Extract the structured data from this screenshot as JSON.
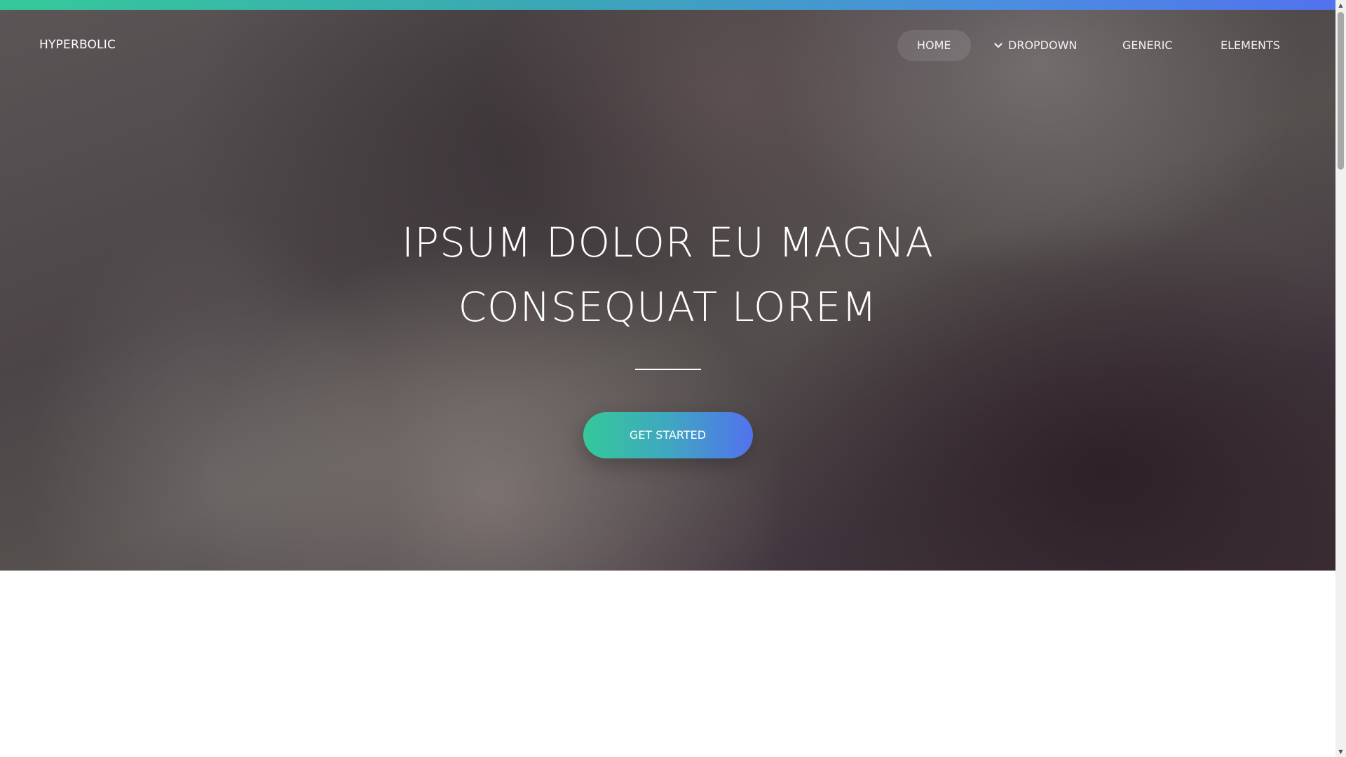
{
  "brand": {
    "name": "HYPERBOLIC"
  },
  "nav": {
    "items": [
      {
        "label": "HOME",
        "active": true
      },
      {
        "label": "DROPDOWN",
        "icon": "chevron-down-icon"
      },
      {
        "label": "GENERIC"
      },
      {
        "label": "ELEMENTS"
      }
    ]
  },
  "hero": {
    "title_line1": "IPSUM DOLOR EU MAGNA",
    "title_line2": "CONSEQUAT LOREM",
    "cta_label": "GET STARTED"
  },
  "colors": {
    "accent_green": "#35c99a",
    "accent_blue": "#5272ee",
    "hero_dark": "#4c4548",
    "text_light": "#ffffff"
  }
}
